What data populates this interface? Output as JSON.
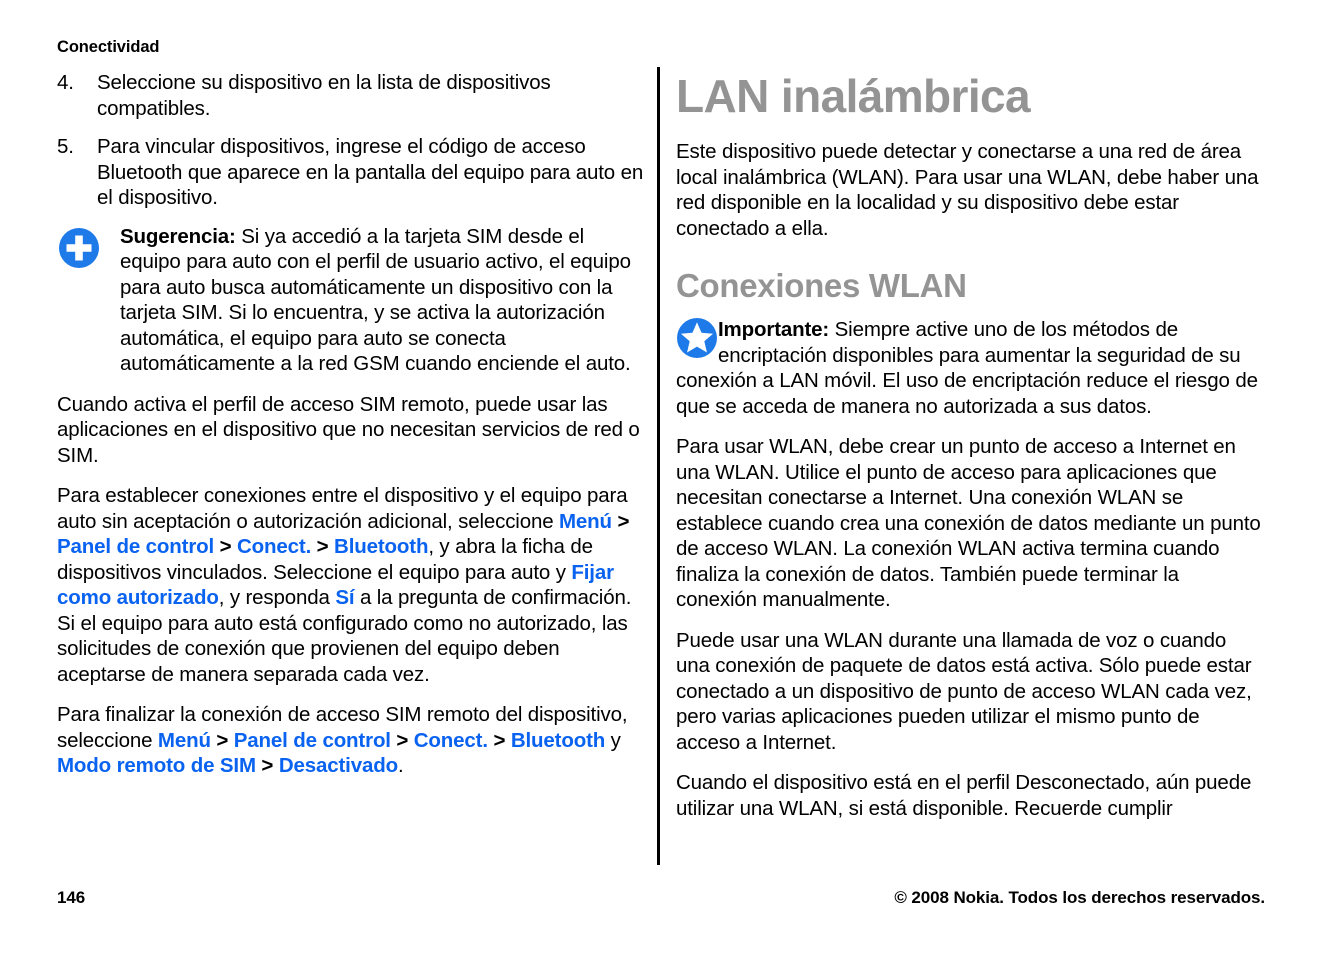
{
  "header": {
    "running_title": "Conectividad"
  },
  "footer": {
    "page_number": "146",
    "copyright": "© 2008 Nokia. Todos los derechos reservados."
  },
  "left_column": {
    "steps": [
      {
        "number": "4.",
        "text": "Seleccione su dispositivo en la lista de dispositivos compatibles."
      },
      {
        "number": "5.",
        "text": "Para vincular dispositivos, ingrese el código de acceso Bluetooth que aparece en la pantalla del equipo para auto en el dispositivo."
      }
    ],
    "tip": {
      "icon": "tip-plus-icon",
      "label": "Sugerencia:",
      "text": " Si ya accedió a la tarjeta SIM desde el equipo para auto con el perfil de usuario activo, el equipo para auto busca automáticamente un dispositivo con la tarjeta SIM. Si lo encuentra, y se activa la autorización automática, el equipo para auto se conecta automáticamente a la red GSM cuando enciende el auto."
    },
    "paragraph_1": "Cuando activa el perfil de acceso SIM remoto, puede usar las aplicaciones en el dispositivo que no necesitan servicios de red o SIM.",
    "paragraph_2": {
      "part_1": "Para establecer conexiones entre el dispositivo y el equipo para auto sin aceptación o autorización adicional, seleccione ",
      "link_1": "Menú",
      "sep_1": " > ",
      "link_2": "Panel de control",
      "sep_2": " > ",
      "link_3": "Conect.",
      "sep_3": " > ",
      "link_4": "Bluetooth",
      "part_2": ", y abra la ficha de dispositivos vinculados. Seleccione el equipo para auto y ",
      "link_5": "Fijar como autorizado",
      "part_3": ", y responda ",
      "link_6": "Sí",
      "part_4": " a la pregunta de confirmación. Si el equipo para auto está configurado como no autorizado, las solicitudes de conexión que provienen del equipo deben aceptarse de manera separada cada vez."
    },
    "paragraph_3": {
      "part_1": "Para finalizar la conexión de acceso SIM remoto del dispositivo, seleccione ",
      "link_1": "Menú",
      "sep_1": " > ",
      "link_2": "Panel de control",
      "sep_2": " > ",
      "link_3": "Conect.",
      "sep_3": " > ",
      "link_4": "Bluetooth",
      "part_2": " y ",
      "link_5": "Modo remoto de SIM",
      "sep_4": " > ",
      "link_6": "Desactivado",
      "part_3": "."
    }
  },
  "right_column": {
    "heading_1": "LAN inalámbrica",
    "intro": "Este dispositivo puede detectar y conectarse a una red de área local inalámbrica (WLAN). Para usar una WLAN, debe haber una red disponible en la localidad y su dispositivo debe estar conectado a ella.",
    "heading_2": "Conexiones WLAN",
    "important": {
      "icon": "important-star-icon",
      "label": "Importante:",
      "text": "  Siempre active uno de los métodos de encriptación disponibles para aumentar la seguridad de su conexión a LAN móvil. El uso de encriptación reduce el riesgo de que se acceda de manera no autorizada a sus datos."
    },
    "paragraph_1": "Para usar WLAN, debe crear un punto de acceso a Internet en una WLAN. Utilice el punto de acceso para aplicaciones que necesitan conectarse a Internet. Una conexión WLAN se establece cuando crea una conexión de datos mediante un punto de acceso WLAN. La conexión WLAN activa termina cuando finaliza la conexión de datos. También puede terminar la conexión manualmente.",
    "paragraph_2": "Puede usar una WLAN durante una llamada de voz o cuando una conexión de paquete de datos está activa. Sólo puede estar conectado a un dispositivo de punto de acceso WLAN cada vez, pero varias aplicaciones pueden utilizar el mismo punto de acceso a Internet.",
    "paragraph_3": "Cuando el dispositivo está en el perfil Desconectado, aún puede utilizar una WLAN, si está disponible. Recuerde cumplir"
  },
  "colors": {
    "link_blue": "#0a63f0",
    "heading_gray": "#949494",
    "icon_blue": "#1d7ae8",
    "text_black": "#000000"
  }
}
